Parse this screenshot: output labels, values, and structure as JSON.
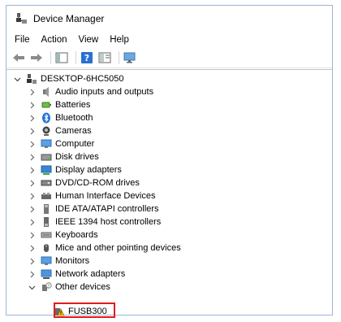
{
  "window": {
    "title": "Device Manager"
  },
  "menu": [
    "File",
    "Action",
    "View",
    "Help"
  ],
  "tree": {
    "root": "DESKTOP-6HC5050",
    "categories": [
      {
        "label": "Audio inputs and outputs",
        "icon": "speaker-icon"
      },
      {
        "label": "Batteries",
        "icon": "battery-icon"
      },
      {
        "label": "Bluetooth",
        "icon": "bluetooth-icon"
      },
      {
        "label": "Cameras",
        "icon": "camera-icon"
      },
      {
        "label": "Computer",
        "icon": "monitor-icon"
      },
      {
        "label": "Disk drives",
        "icon": "disk-drive-icon"
      },
      {
        "label": "Display adapters",
        "icon": "display-adapter-icon"
      },
      {
        "label": "DVD/CD-ROM drives",
        "icon": "dvd-drive-icon"
      },
      {
        "label": "Human Interface Devices",
        "icon": "hid-icon"
      },
      {
        "label": "IDE ATA/ATAPI controllers",
        "icon": "ide-controller-icon"
      },
      {
        "label": "IEEE 1394 host controllers",
        "icon": "firewire-icon"
      },
      {
        "label": "Keyboards",
        "icon": "keyboard-icon"
      },
      {
        "label": "Mice and other pointing devices",
        "icon": "mouse-icon"
      },
      {
        "label": "Monitors",
        "icon": "monitor-icon"
      },
      {
        "label": "Network adapters",
        "icon": "network-icon"
      },
      {
        "label": "Other devices",
        "icon": "other-devices-icon"
      }
    ],
    "other_devices_child": {
      "label": "FUSB300",
      "icon": "warning-device-icon"
    }
  },
  "colors": {
    "accent": "#2a6fd1",
    "highlight": "#e21b1b",
    "warning": "#f3c300"
  }
}
